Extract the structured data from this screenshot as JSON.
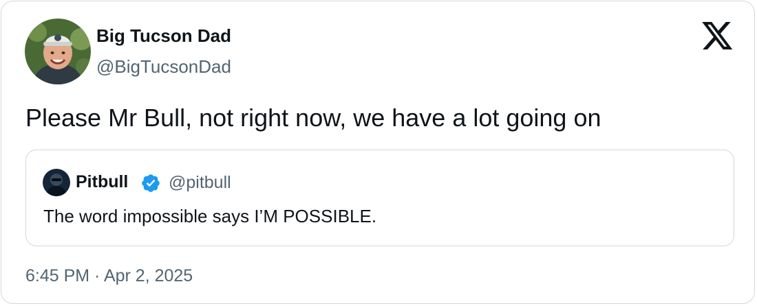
{
  "author": {
    "name": "Big Tucson Dad",
    "handle": "@BigTucsonDad"
  },
  "tweet": {
    "text": "Please Mr Bull, not right now, we have a lot going on",
    "timestamp": "6:45 PM · Apr 2, 2025"
  },
  "quoted_tweet": {
    "name": "Pitbull",
    "handle": "@pitbull",
    "verified": true,
    "text": "The word impossible says I’M POSSIBLE."
  },
  "icons": {
    "platform": "x-logo-icon",
    "verified": "verified-badge-icon"
  },
  "colors": {
    "text_primary": "#0f1419",
    "text_secondary": "#536471",
    "border": "#cfd9de",
    "verified_blue": "#1d9bf0"
  }
}
